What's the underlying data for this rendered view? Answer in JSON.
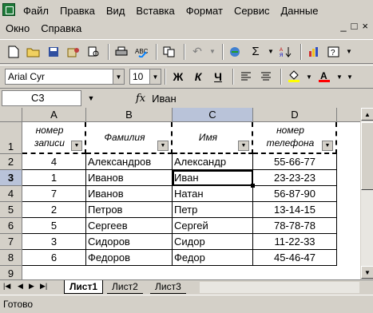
{
  "menu": {
    "row1": [
      "Файл",
      "Правка",
      "Вид",
      "Вставка",
      "Формат",
      "Сервис",
      "Данные"
    ],
    "row2": [
      "Окно",
      "Справка"
    ]
  },
  "window_controls": [
    "_",
    "□",
    "×"
  ],
  "toolbar": {
    "font_name": "Arial Cyr",
    "font_size": "10",
    "bold": "Ж",
    "italic": "К",
    "underline": "Ч"
  },
  "formula_bar": {
    "cell_ref": "C3",
    "fx": "fx",
    "content": "Иван"
  },
  "grid": {
    "columns": [
      "A",
      "B",
      "C",
      "D"
    ],
    "rows": [
      "1",
      "2",
      "3",
      "4",
      "5",
      "6",
      "7",
      "8",
      "9"
    ],
    "header": [
      "номер записи",
      "Фамилия",
      "Имя",
      "номер телефона"
    ],
    "data": [
      [
        "4",
        "Александров",
        "Александр",
        "55-66-77"
      ],
      [
        "1",
        "Иванов",
        "Иван",
        "23-23-23"
      ],
      [
        "7",
        "Иванов",
        "Натан",
        "56-87-90"
      ],
      [
        "2",
        "Петров",
        "Петр",
        "13-14-15"
      ],
      [
        "5",
        "Сергеев",
        "Сергей",
        "78-78-78"
      ],
      [
        "3",
        "Сидоров",
        "Сидор",
        "11-22-33"
      ],
      [
        "6",
        "Федоров",
        "Федор",
        "45-46-47"
      ]
    ]
  },
  "sheets": [
    "Лист1",
    "Лист2",
    "Лист3"
  ],
  "status": "Готово"
}
